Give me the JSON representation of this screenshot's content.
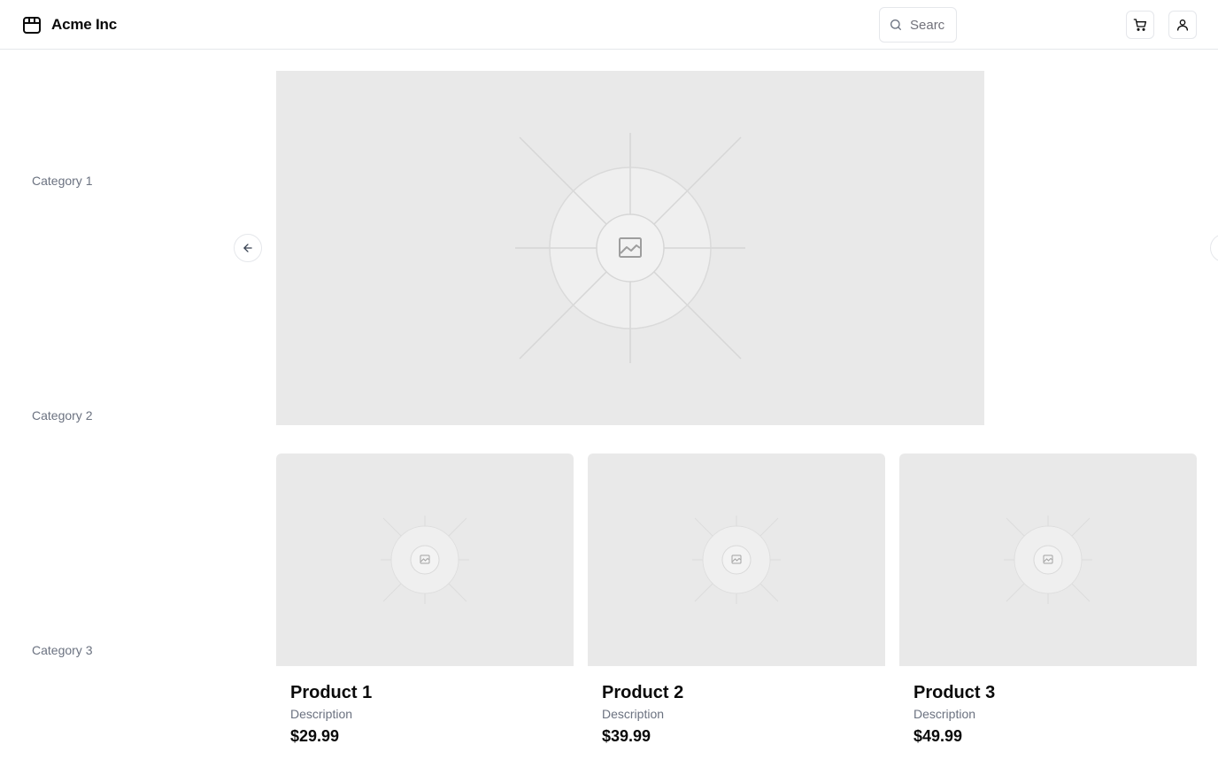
{
  "header": {
    "brand_name": "Acme Inc",
    "brand_icon": "package-icon",
    "search": {
      "placeholder": "Search",
      "value": "",
      "icon": "search-icon"
    },
    "cart_icon": "shopping-cart-icon",
    "user_icon": "user-icon"
  },
  "sidebar": {
    "items": [
      {
        "label": "Category 1"
      },
      {
        "label": "Category 2"
      },
      {
        "label": "Category 3"
      }
    ]
  },
  "carousel": {
    "prev_icon": "arrow-left-icon",
    "next_icon": "arrow-right-icon",
    "slide_icon": "image-placeholder-icon"
  },
  "products": [
    {
      "name": "Product 1",
      "description": "Description",
      "price": "$29.99"
    },
    {
      "name": "Product 2",
      "description": "Description",
      "price": "$39.99"
    },
    {
      "name": "Product 3",
      "description": "Description",
      "price": "$49.99"
    }
  ],
  "colors": {
    "placeholder_bg": "#e9e9e9",
    "muted_text": "#6b7280",
    "border": "#e5e7eb"
  }
}
